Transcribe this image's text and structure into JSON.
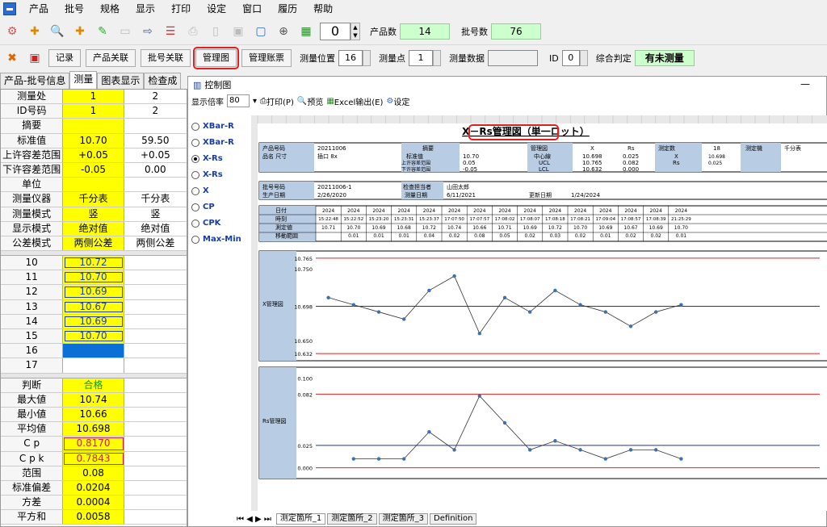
{
  "menu": [
    "产品",
    "批号",
    "规格",
    "显示",
    "打印",
    "设定",
    "窗口",
    "履历",
    "帮助"
  ],
  "toolbar": {
    "count_value": "0",
    "product_count_label": "产品数",
    "product_count": "14",
    "lot_count_label": "批号数",
    "lot_count": "76"
  },
  "toolbar2": {
    "buttons": [
      "记录",
      "产品关联",
      "批号关联",
      "管理图",
      "管理账票"
    ],
    "pos_label": "测量位置",
    "pos_value": "16",
    "point_label": "测量点",
    "point_value": "1",
    "data_label": "测量数据",
    "id_label": "ID",
    "id_value": "0",
    "judge_label": "综合判定",
    "judge_value": "有未测量"
  },
  "left_tabs": [
    "产品-批号信息",
    "测量",
    "图表显示",
    "检查成"
  ],
  "grid_top": [
    [
      "测量处",
      "1",
      "2"
    ],
    [
      "ID号码",
      "1",
      "2"
    ],
    [
      "摘要",
      "",
      ""
    ],
    [
      "标准值",
      "10.70",
      "59.50"
    ],
    [
      "上许容差范围",
      "+0.05",
      "+0.05"
    ],
    [
      "下许容差范围",
      "-0.05",
      "0.00"
    ],
    [
      "单位",
      "",
      ""
    ],
    [
      "测量仪器",
      "千分表",
      "千分表"
    ],
    [
      "测量模式",
      "竖",
      "竖"
    ],
    [
      "显示模式",
      "绝对值",
      "绝对值"
    ],
    [
      "公差模式",
      "两侧公差",
      "两侧公差"
    ]
  ],
  "grid_mid": [
    [
      "10",
      "10.72"
    ],
    [
      "11",
      "10.70"
    ],
    [
      "12",
      "10.69"
    ],
    [
      "13",
      "10.67"
    ],
    [
      "14",
      "10.69"
    ],
    [
      "15",
      "10.70"
    ],
    [
      "16",
      ""
    ],
    [
      "17",
      ""
    ]
  ],
  "grid_bot": [
    [
      "判断",
      "合格"
    ],
    [
      "最大値",
      "10.74"
    ],
    [
      "最小値",
      "10.66"
    ],
    [
      "平均値",
      "10.698"
    ],
    [
      "C p",
      "0.8170"
    ],
    [
      "C p k",
      "0.7843"
    ],
    [
      "范围",
      "0.08"
    ],
    [
      "标准偏差",
      "0.0204"
    ],
    [
      "方差",
      "0.0004"
    ],
    [
      "平方和",
      "0.0058"
    ]
  ],
  "window": {
    "title": "控制图",
    "zoom_label": "显示倍率",
    "zoom": "80",
    "print": "打印(P)",
    "preview": "预览",
    "excel": "Excel输出(E)",
    "settings": "设定",
    "radios": [
      "XBar-R",
      "XBar-R",
      "X-Rs",
      "X-Rs",
      "X",
      "CP",
      "CPK",
      "Max-Min"
    ],
    "sheet_tabs": [
      "测定箇所_1",
      "测定箇所_2",
      "测定箇所_3",
      "Definition"
    ]
  },
  "sheet": {
    "title": "X－Rs管理図（単一ロット）",
    "info": {
      "product_no_label": "产品号码",
      "product_no": "20211006",
      "name_label": "品名 尺寸",
      "name": "插口 8x",
      "summary_label": "摘要",
      "std_label": "标准值",
      "std": "10.70",
      "upper_label": "上许容差范围",
      "upper": "0.05",
      "lower_label": "下许容差范围",
      "lower": "-0.05",
      "mgmt_label": "管理図",
      "x_label": "X",
      "rs_label": "Rs",
      "center_label": "中心線",
      "center_x": "10.698",
      "center_rs": "0.025",
      "ucl_label": "UCL",
      "ucl_x": "10.765",
      "ucl_rs": "0.082",
      "lcl_label": "LCL",
      "lcl_x": "10.632",
      "lcl_rs": "0.000",
      "count_label": "测定数",
      "count": "18",
      "instr_label": "测定機",
      "instr": "千分表",
      "xv": "10.698",
      "rsv": "0.025",
      "lot_label": "批号号码",
      "lot": "20211006-1",
      "date_label": "生产日期",
      "date": "2/26/2020",
      "inspector_label": "检查担当者",
      "inspector": "山田太郎",
      "mdate_label": "测量日期",
      "mdate": "6/11/2021",
      "update_label": "更新日期",
      "update": "1/24/2024"
    },
    "row_labels": [
      "日付",
      "時刻",
      "測定値",
      "移動範囲"
    ],
    "dates": [
      "2024",
      "2024",
      "2024",
      "2024",
      "2024",
      "2024",
      "2024",
      "2024",
      "2024",
      "2024",
      "2024",
      "2024",
      "2024",
      "2024",
      "2024"
    ],
    "times": [
      "15:22:48",
      "15:22:52",
      "15:23:20",
      "15:23:31",
      "15:23:37",
      "17:07:50",
      "17:07:57",
      "17:08:02",
      "17:08:07",
      "17:08:18",
      "17:08:21",
      "17:09:04",
      "17:08:57",
      "17:08:39",
      "21:25:29"
    ],
    "values": [
      "10.71",
      "10.70",
      "10.69",
      "10.68",
      "10.72",
      "10.74",
      "10.66",
      "10.71",
      "10.69",
      "10.72",
      "10.70",
      "10.69",
      "10.67",
      "10.69",
      "10.70"
    ],
    "ranges": [
      "",
      "0.01",
      "0.01",
      "0.01",
      "0.04",
      "0.02",
      "0.08",
      "0.05",
      "0.02",
      "0.03",
      "0.02",
      "0.01",
      "0.02",
      "0.02",
      "0.01"
    ],
    "x_chart_label": "X管理図",
    "rs_chart_label": "Rs管理図",
    "x_ticks": [
      "10.765",
      "10.750",
      "10.698",
      "10.650",
      "10.632"
    ],
    "rs_ticks": [
      "0.100",
      "0.082",
      "0.025",
      "0.000"
    ]
  },
  "chart_data": [
    {
      "type": "line",
      "title": "X管理図",
      "x": [
        1,
        2,
        3,
        4,
        5,
        6,
        7,
        8,
        9,
        10,
        11,
        12,
        13,
        14,
        15
      ],
      "series": [
        {
          "values": [
            10.71,
            10.7,
            10.69,
            10.68,
            10.72,
            10.74,
            10.66,
            10.71,
            10.69,
            10.72,
            10.7,
            10.69,
            10.67,
            10.69,
            10.7
          ]
        }
      ],
      "ucl": 10.765,
      "center": 10.698,
      "lcl": 10.632,
      "ylim": [
        10.622,
        10.775
      ],
      "tick_labels": [
        "10.765",
        "10.750",
        "10.698",
        "10.650",
        "10.632"
      ]
    },
    {
      "type": "line",
      "title": "Rs管理図",
      "x": [
        2,
        3,
        4,
        5,
        6,
        7,
        8,
        9,
        10,
        11,
        12,
        13,
        14,
        15
      ],
      "series": [
        {
          "values": [
            0.01,
            0.01,
            0.01,
            0.04,
            0.02,
            0.08,
            0.05,
            0.02,
            0.03,
            0.02,
            0.01,
            0.02,
            0.02,
            0.01
          ]
        }
      ],
      "ucl": 0.082,
      "center": 0.025,
      "lcl": 0.0,
      "ylim": [
        -0.012,
        0.112
      ],
      "tick_labels": [
        "0.100",
        "0.082",
        "0.025",
        "0.000"
      ]
    }
  ]
}
